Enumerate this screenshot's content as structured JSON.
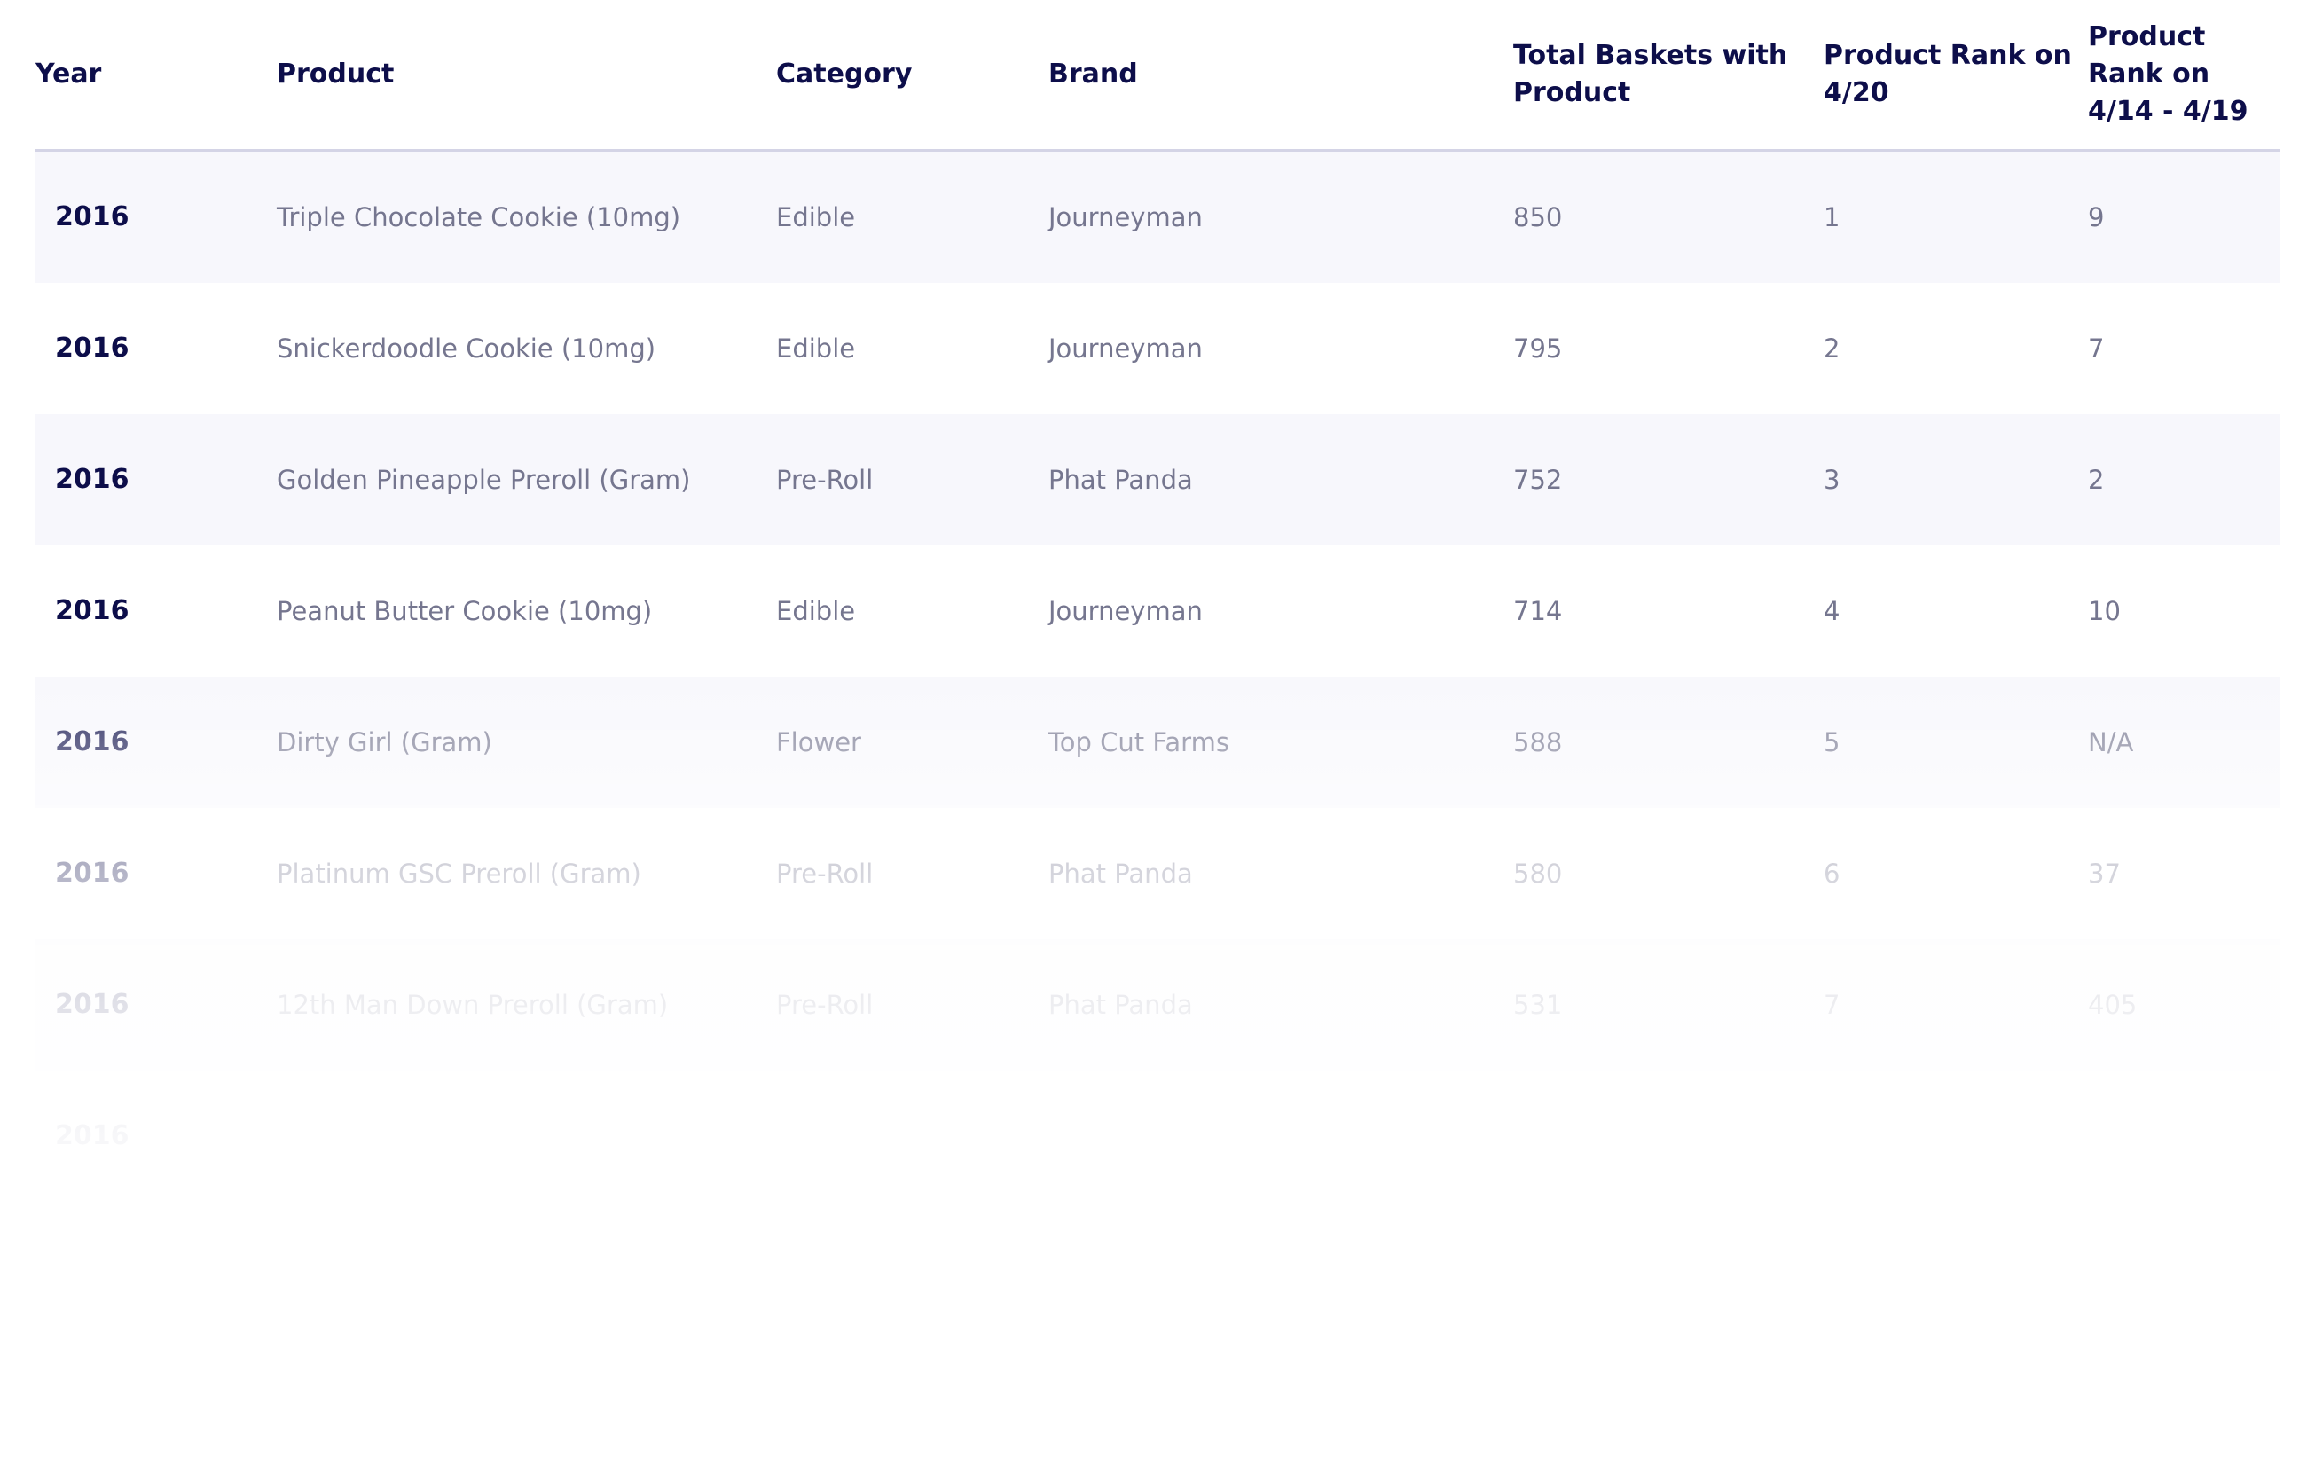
{
  "table": {
    "headers": [
      "Year",
      "Product",
      "Category",
      "Brand",
      "Total Baskets with Product",
      "Product Rank on 4/20",
      "Product Rank on 4/14 - 4/19"
    ],
    "rows": [
      [
        "2016",
        "Triple Chocolate Cookie (10mg)",
        "Edible",
        "Journeyman",
        "850",
        "1",
        "9"
      ],
      [
        "2016",
        "Snickerdoodle Cookie (10mg)",
        "Edible",
        "Journeyman",
        "795",
        "2",
        "7"
      ],
      [
        "2016",
        "Golden Pineapple Preroll (Gram)",
        "Pre-Roll",
        "Phat Panda",
        "752",
        "3",
        "2"
      ],
      [
        "2016",
        "Peanut Butter Cookie (10mg)",
        "Edible",
        "Journeyman",
        "714",
        "4",
        "10"
      ],
      [
        "2016",
        "Dirty Girl (Gram)",
        "Flower",
        "Top Cut Farms",
        "588",
        "5",
        "N/A"
      ],
      [
        "2016",
        "Platinum GSC Preroll (Gram)",
        "Pre-Roll",
        "Phat Panda",
        "580",
        "6",
        "37"
      ],
      [
        "2016",
        "12th Man Down Preroll (Gram)",
        "Pre-Roll",
        "Phat Panda",
        "531",
        "7",
        "405"
      ],
      [
        "2016",
        "",
        "",
        "",
        "",
        "",
        ""
      ]
    ]
  },
  "colors": {
    "header_text": "#0d0e4a",
    "body_text": "#75768f",
    "row_shade": "#f7f7fc",
    "divider": "#d4d4e6"
  }
}
